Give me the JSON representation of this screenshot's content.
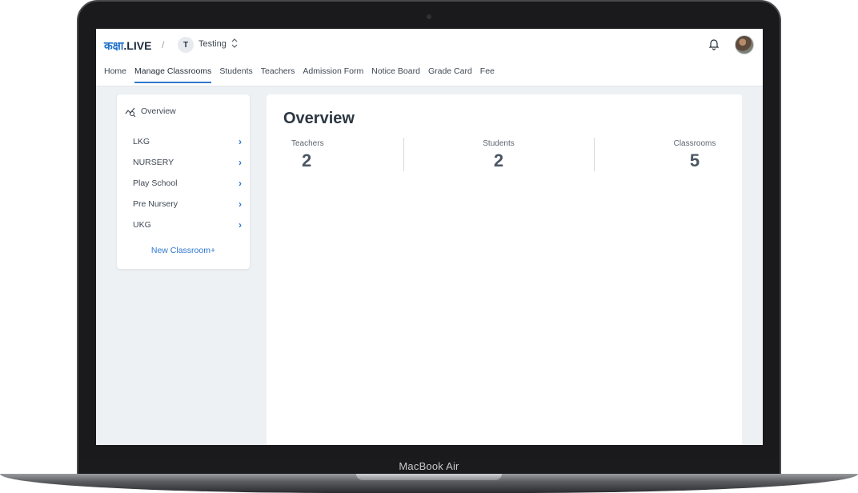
{
  "device": {
    "label": "MacBook Air"
  },
  "header": {
    "brand_hi": "कक्षा",
    "brand_en": ".LIVE",
    "separator": "/",
    "workspace_initial": "T",
    "workspace_name": "Testing",
    "workspace_toggle": "⌃⌄"
  },
  "nav": {
    "items": [
      {
        "label": "Home"
      },
      {
        "label": "Manage Classrooms",
        "active": true
      },
      {
        "label": "Students"
      },
      {
        "label": "Teachers"
      },
      {
        "label": "Admission Form"
      },
      {
        "label": "Notice Board"
      },
      {
        "label": "Grade Card"
      },
      {
        "label": "Fee"
      }
    ]
  },
  "sidebar": {
    "overview_label": "Overview",
    "classes": [
      {
        "label": "LKG",
        "chevron": "›"
      },
      {
        "label": "NURSERY",
        "chevron": "›"
      },
      {
        "label": "Play School",
        "chevron": "›"
      },
      {
        "label": "Pre Nursery",
        "chevron": "›"
      },
      {
        "label": "UKG",
        "chevron": "›"
      }
    ],
    "new_classroom_label": "New Classroom+"
  },
  "main": {
    "title": "Overview",
    "stats": {
      "teachers": {
        "label": "Teachers",
        "value": "2"
      },
      "students": {
        "label": "Students",
        "value": "2"
      },
      "classrooms": {
        "label": "Classrooms",
        "value": "5"
      }
    }
  },
  "colors": {
    "accent": "#2f78cf",
    "brand_blue": "#1f6fc9",
    "page_bg": "#eef1f3"
  }
}
